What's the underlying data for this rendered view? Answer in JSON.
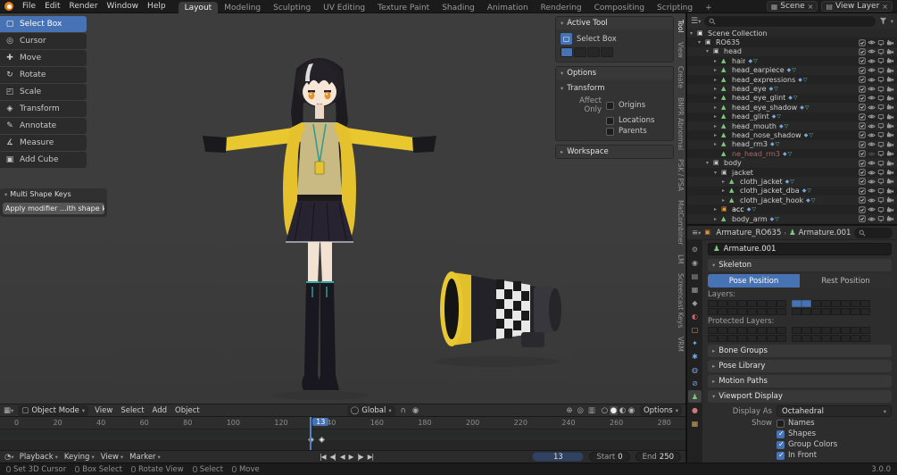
{
  "topbar": {
    "menus": [
      "File",
      "Edit",
      "Render",
      "Window",
      "Help"
    ],
    "tabs": [
      {
        "label": "Layout",
        "cls": "active"
      },
      {
        "label": "Modeling"
      },
      {
        "label": "Sculpting"
      },
      {
        "label": "UV Editing"
      },
      {
        "label": "Texture Paint"
      },
      {
        "label": "Shading"
      },
      {
        "label": "Animation"
      },
      {
        "label": "Rendering"
      },
      {
        "label": "Compositing"
      },
      {
        "label": "Scripting"
      },
      {
        "label": "+"
      }
    ],
    "scene_label": "Scene",
    "view_layer_label": "View Layer"
  },
  "toolbar": {
    "tools": [
      {
        "icon": "▢",
        "label": "Select Box",
        "cls": "active",
        "name": "select-box"
      },
      {
        "icon": "◎",
        "label": "Cursor",
        "name": "cursor"
      },
      {
        "icon": "✚",
        "label": "Move",
        "name": "move"
      },
      {
        "icon": "↻",
        "label": "Rotate",
        "name": "rotate"
      },
      {
        "icon": "◰",
        "label": "Scale",
        "name": "scale"
      },
      {
        "icon": "◈",
        "label": "Transform",
        "name": "transform"
      },
      {
        "icon": "✎",
        "label": "Annotate",
        "name": "annotate"
      },
      {
        "icon": "∡",
        "label": "Measure",
        "name": "measure"
      },
      {
        "icon": "▣",
        "label": "Add Cube",
        "name": "add-cube"
      }
    ],
    "shapekeys_title": "Multi Shape Keys",
    "shapekeys_button": "Apply modifier ...ith shape keys"
  },
  "npanel": {
    "active_tool_title": "Active Tool",
    "tool_name": "Select Box",
    "options_title": "Options",
    "transform_title": "Transform",
    "affect_only_label": "Affect Only",
    "checkboxes": [
      "Origins",
      "Locations",
      "Parents"
    ],
    "workspace_title": "Workspace",
    "tabs": [
      {
        "label": "Tool",
        "cls": "active"
      },
      {
        "label": "View"
      },
      {
        "label": "Create"
      },
      {
        "label": "BNPR Abnormal"
      },
      {
        "label": "PSK / PSA"
      },
      {
        "label": "MatCombiner"
      },
      {
        "label": "LM"
      },
      {
        "label": "Screencast Keys"
      },
      {
        "label": "VRM"
      }
    ]
  },
  "outliner": {
    "rows": [
      {
        "cls": "ind0 no-toggles",
        "arrow": "▾",
        "icon": "ic-col-main",
        "label": "Scene Collection"
      },
      {
        "cls": "ind1",
        "arrow": "▾",
        "icon": "ic-col",
        "label": "RO635"
      },
      {
        "cls": "ind2",
        "arrow": "▾",
        "icon": "ic-col",
        "label": "head"
      },
      {
        "cls": "ind3 mesh-row",
        "arrow": "▸",
        "icon": "ic-mesh",
        "label": "hair"
      },
      {
        "cls": "ind3 mesh-row",
        "arrow": "▸",
        "icon": "ic-mesh",
        "label": "head_earpiece"
      },
      {
        "cls": "ind3 mesh-row",
        "arrow": "▸",
        "icon": "ic-mesh",
        "label": "head_expressions"
      },
      {
        "cls": "ind3 mesh-row",
        "arrow": "▸",
        "icon": "ic-mesh",
        "label": "head_eye"
      },
      {
        "cls": "ind3 mesh-row",
        "arrow": "▸",
        "icon": "ic-mesh",
        "label": "head_eye_glint"
      },
      {
        "cls": "ind3 mesh-row",
        "arrow": "▸",
        "icon": "ic-mesh",
        "label": "head_eye_shadow"
      },
      {
        "cls": "ind3 mesh-row",
        "arrow": "▸",
        "icon": "ic-mesh",
        "label": "head_glint"
      },
      {
        "cls": "ind3 mesh-row",
        "arrow": "▸",
        "icon": "ic-mesh",
        "label": "head_mouth"
      },
      {
        "cls": "ind3 mesh-row",
        "arrow": "▸",
        "icon": "ic-mesh",
        "label": "head_nose_shadow"
      },
      {
        "cls": "ind3 mesh-row",
        "arrow": "▸",
        "icon": "ic-mesh",
        "label": "head_rm3"
      },
      {
        "cls": "ind3 mesh-row hidden-row",
        "arrow": "",
        "icon": "ic-mesh",
        "label": "ne_head_rm3"
      },
      {
        "cls": "ind2",
        "arrow": "▾",
        "icon": "ic-col",
        "label": "body"
      },
      {
        "cls": "ind3",
        "arrow": "▾",
        "icon": "ic-col",
        "label": "jacket"
      },
      {
        "cls": "ind4 mesh-row",
        "arrow": "▸",
        "icon": "ic-mesh",
        "label": "cloth_jacket"
      },
      {
        "cls": "ind4 mesh-row",
        "arrow": "▸",
        "icon": "ic-mesh",
        "label": "cloth_jacket_dba"
      },
      {
        "cls": "ind4 mesh-row",
        "arrow": "▸",
        "icon": "ic-mesh",
        "label": "cloth_jacket_hook"
      },
      {
        "cls": "ind3 mesh-row sel-row",
        "arrow": "▸",
        "icon": "ic-obj",
        "label": "acc"
      },
      {
        "cls": "ind3 mesh-row",
        "arrow": "▸",
        "icon": "ic-mesh",
        "label": "body_arm"
      }
    ]
  },
  "properties": {
    "tabs": [
      {
        "g": "⚙",
        "c": "#9a9a9a",
        "cls": "",
        "n": "tool"
      },
      {
        "g": "◉",
        "c": "#9a9a9a",
        "cls": "",
        "n": "render"
      },
      {
        "g": "▤",
        "c": "#9a9a9a",
        "cls": "",
        "n": "output"
      },
      {
        "g": "▦",
        "c": "#9a9a9a",
        "cls": "",
        "n": "view-layer"
      },
      {
        "g": "◆",
        "c": "#9a9a9a",
        "cls": "",
        "n": "scene"
      },
      {
        "g": "◐",
        "c": "#c86a6a",
        "cls": "",
        "n": "world"
      },
      {
        "g": "▢",
        "c": "#e8983a",
        "cls": "",
        "n": "object"
      },
      {
        "g": "✦",
        "c": "#7aa5d8",
        "cls": "",
        "n": "modifiers"
      },
      {
        "g": "✱",
        "c": "#7aa5d8",
        "cls": "",
        "n": "particles"
      },
      {
        "g": "◍",
        "c": "#7aa5d8",
        "cls": "",
        "n": "physics"
      },
      {
        "g": "⊘",
        "c": "#7aa5d8",
        "cls": "",
        "n": "constraints"
      },
      {
        "g": "♟",
        "c": "#7fc97f",
        "cls": "active",
        "n": "object-data"
      },
      {
        "g": "●",
        "c": "#c87a7a",
        "cls": "",
        "n": "material"
      },
      {
        "g": "▦",
        "c": "#c8a05a",
        "cls": "",
        "n": "texture"
      }
    ],
    "breadcrumb_object": "Armature_RO635",
    "breadcrumb_sep": "›",
    "breadcrumb_data": "Armature.001",
    "name_value": "Armature.001",
    "skeleton_title": "Skeleton",
    "pose_button": "Pose Position",
    "rest_button": "Rest Position",
    "layers_label": "Layers:",
    "layers_r1_active": "8,9",
    "layers_r2_active": "",
    "protected_label": "Protected Layers:",
    "protected_r1_active": "",
    "protected_r2_active": "",
    "collapsed_panels": [
      "Bone Groups",
      "Pose Library",
      "Motion Paths"
    ],
    "vd_title": "Viewport Display",
    "display_as_label": "Display As",
    "display_as_value": "Octahedral",
    "show_label": "Show",
    "show_checkboxes": [
      {
        "label": "Names",
        "cls": ""
      },
      {
        "label": "Shapes",
        "cls": "on"
      },
      {
        "label": "Group Colors",
        "cls": "on"
      },
      {
        "label": "In Front",
        "cls": "on"
      }
    ]
  },
  "viewport_header": {
    "mode_label": "Object Mode",
    "menus": [
      "View",
      "Select",
      "Add",
      "Object"
    ],
    "orientation_label": "Global",
    "view_icons": [
      {
        "g": "⊕",
        "n": "gizmos-icon"
      },
      {
        "g": "◎",
        "n": "overlays-icon"
      },
      {
        "g": "▥",
        "n": "xray-icon"
      }
    ],
    "shading_icons": [
      {
        "g": "○",
        "cls": "",
        "n": "wireframe-shading-icon"
      },
      {
        "g": "●",
        "cls": "active",
        "n": "solid-shading-icon"
      },
      {
        "g": "◐",
        "cls": "",
        "n": "material-shading-icon"
      },
      {
        "g": "◉",
        "cls": "",
        "n": "rendered-shading-icon"
      }
    ],
    "options_label": "Options"
  },
  "timeline": {
    "ticks": [
      "0",
      "20",
      "40",
      "60",
      "80",
      "100",
      "120",
      "140",
      "160",
      "180",
      "200",
      "220",
      "240",
      "260",
      "280"
    ],
    "current_frame": "13",
    "playhead_pct": 45.2,
    "keyframes": [
      "45.0%",
      "46.6%"
    ]
  },
  "playbar": {
    "menus": [
      "Playback",
      "Keying",
      "View",
      "Marker"
    ],
    "transport": [
      {
        "g": "|◀",
        "n": "jump-start-button"
      },
      {
        "g": "◀|",
        "n": "prev-keyframe-button"
      },
      {
        "g": "◀",
        "n": "play-reverse-button"
      },
      {
        "g": "▶",
        "n": "play-button"
      },
      {
        "g": "|▶",
        "n": "next-keyframe-button"
      },
      {
        "g": "▶|",
        "n": "jump-end-button"
      }
    ],
    "frame_value": "13",
    "start_label": "Start",
    "start_value": "0",
    "end_label": "End",
    "end_value": "250"
  },
  "statusbar": {
    "hints": [
      "Set 3D Cursor",
      "Box Select",
      "Rotate View",
      "Select",
      "Move"
    ],
    "version": "3.0.0"
  }
}
